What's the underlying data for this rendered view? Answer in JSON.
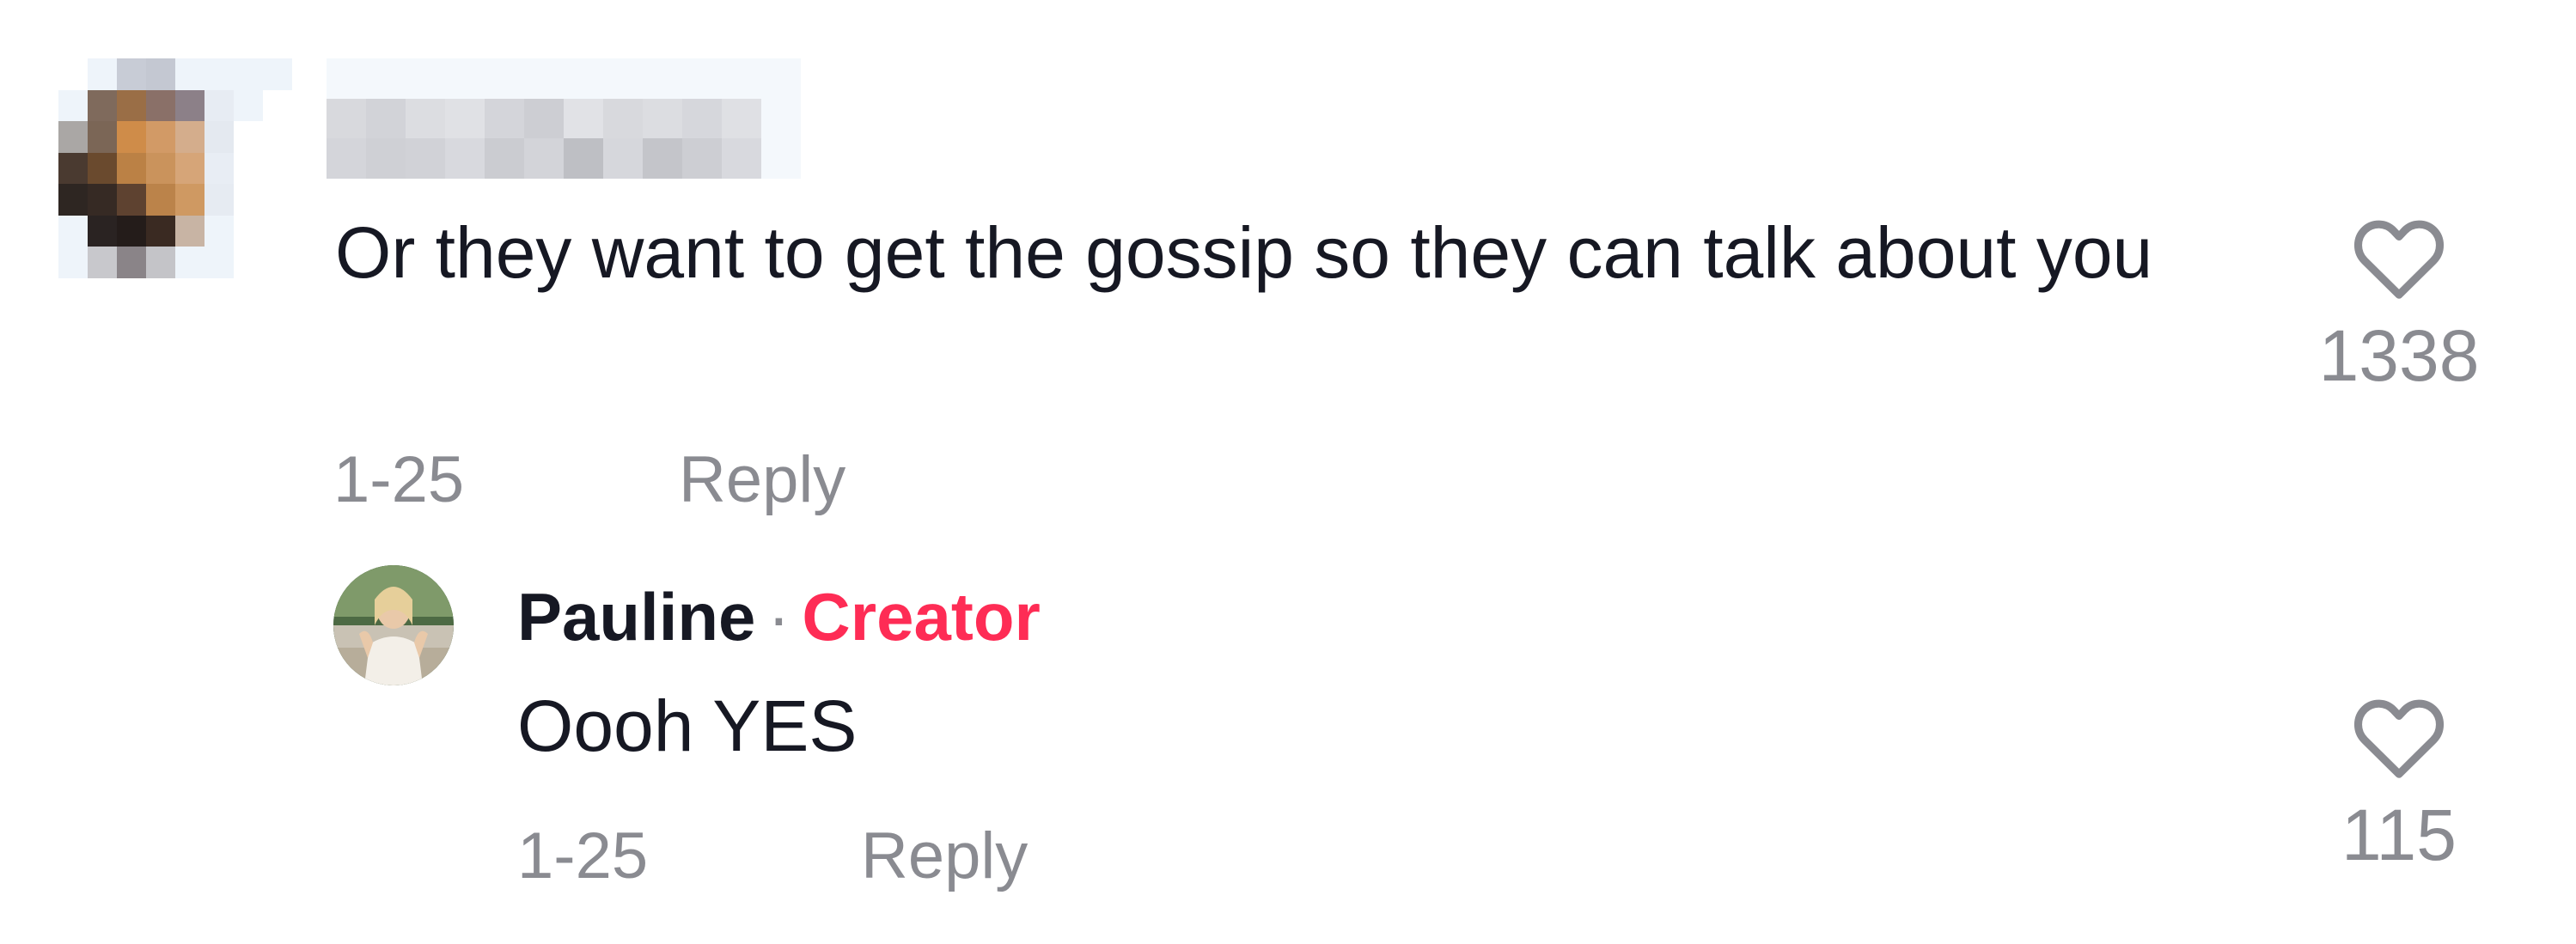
{
  "comment": {
    "text": "Or they want to get the gossip so they can talk about you",
    "date": "1-25",
    "reply_label": "Reply",
    "like_count": "1338",
    "like_icon": "heart-outline-icon"
  },
  "creator_reply": {
    "name": "Pauline",
    "separator": "·",
    "badge": "Creator",
    "text": "Oooh YES",
    "date": "1-25",
    "reply_label": "Reply",
    "like_count": "115",
    "like_icon": "heart-outline-icon"
  },
  "colors": {
    "text_primary": "#161823",
    "text_secondary": "#8a8b91",
    "creator_badge": "#fe2c55"
  }
}
